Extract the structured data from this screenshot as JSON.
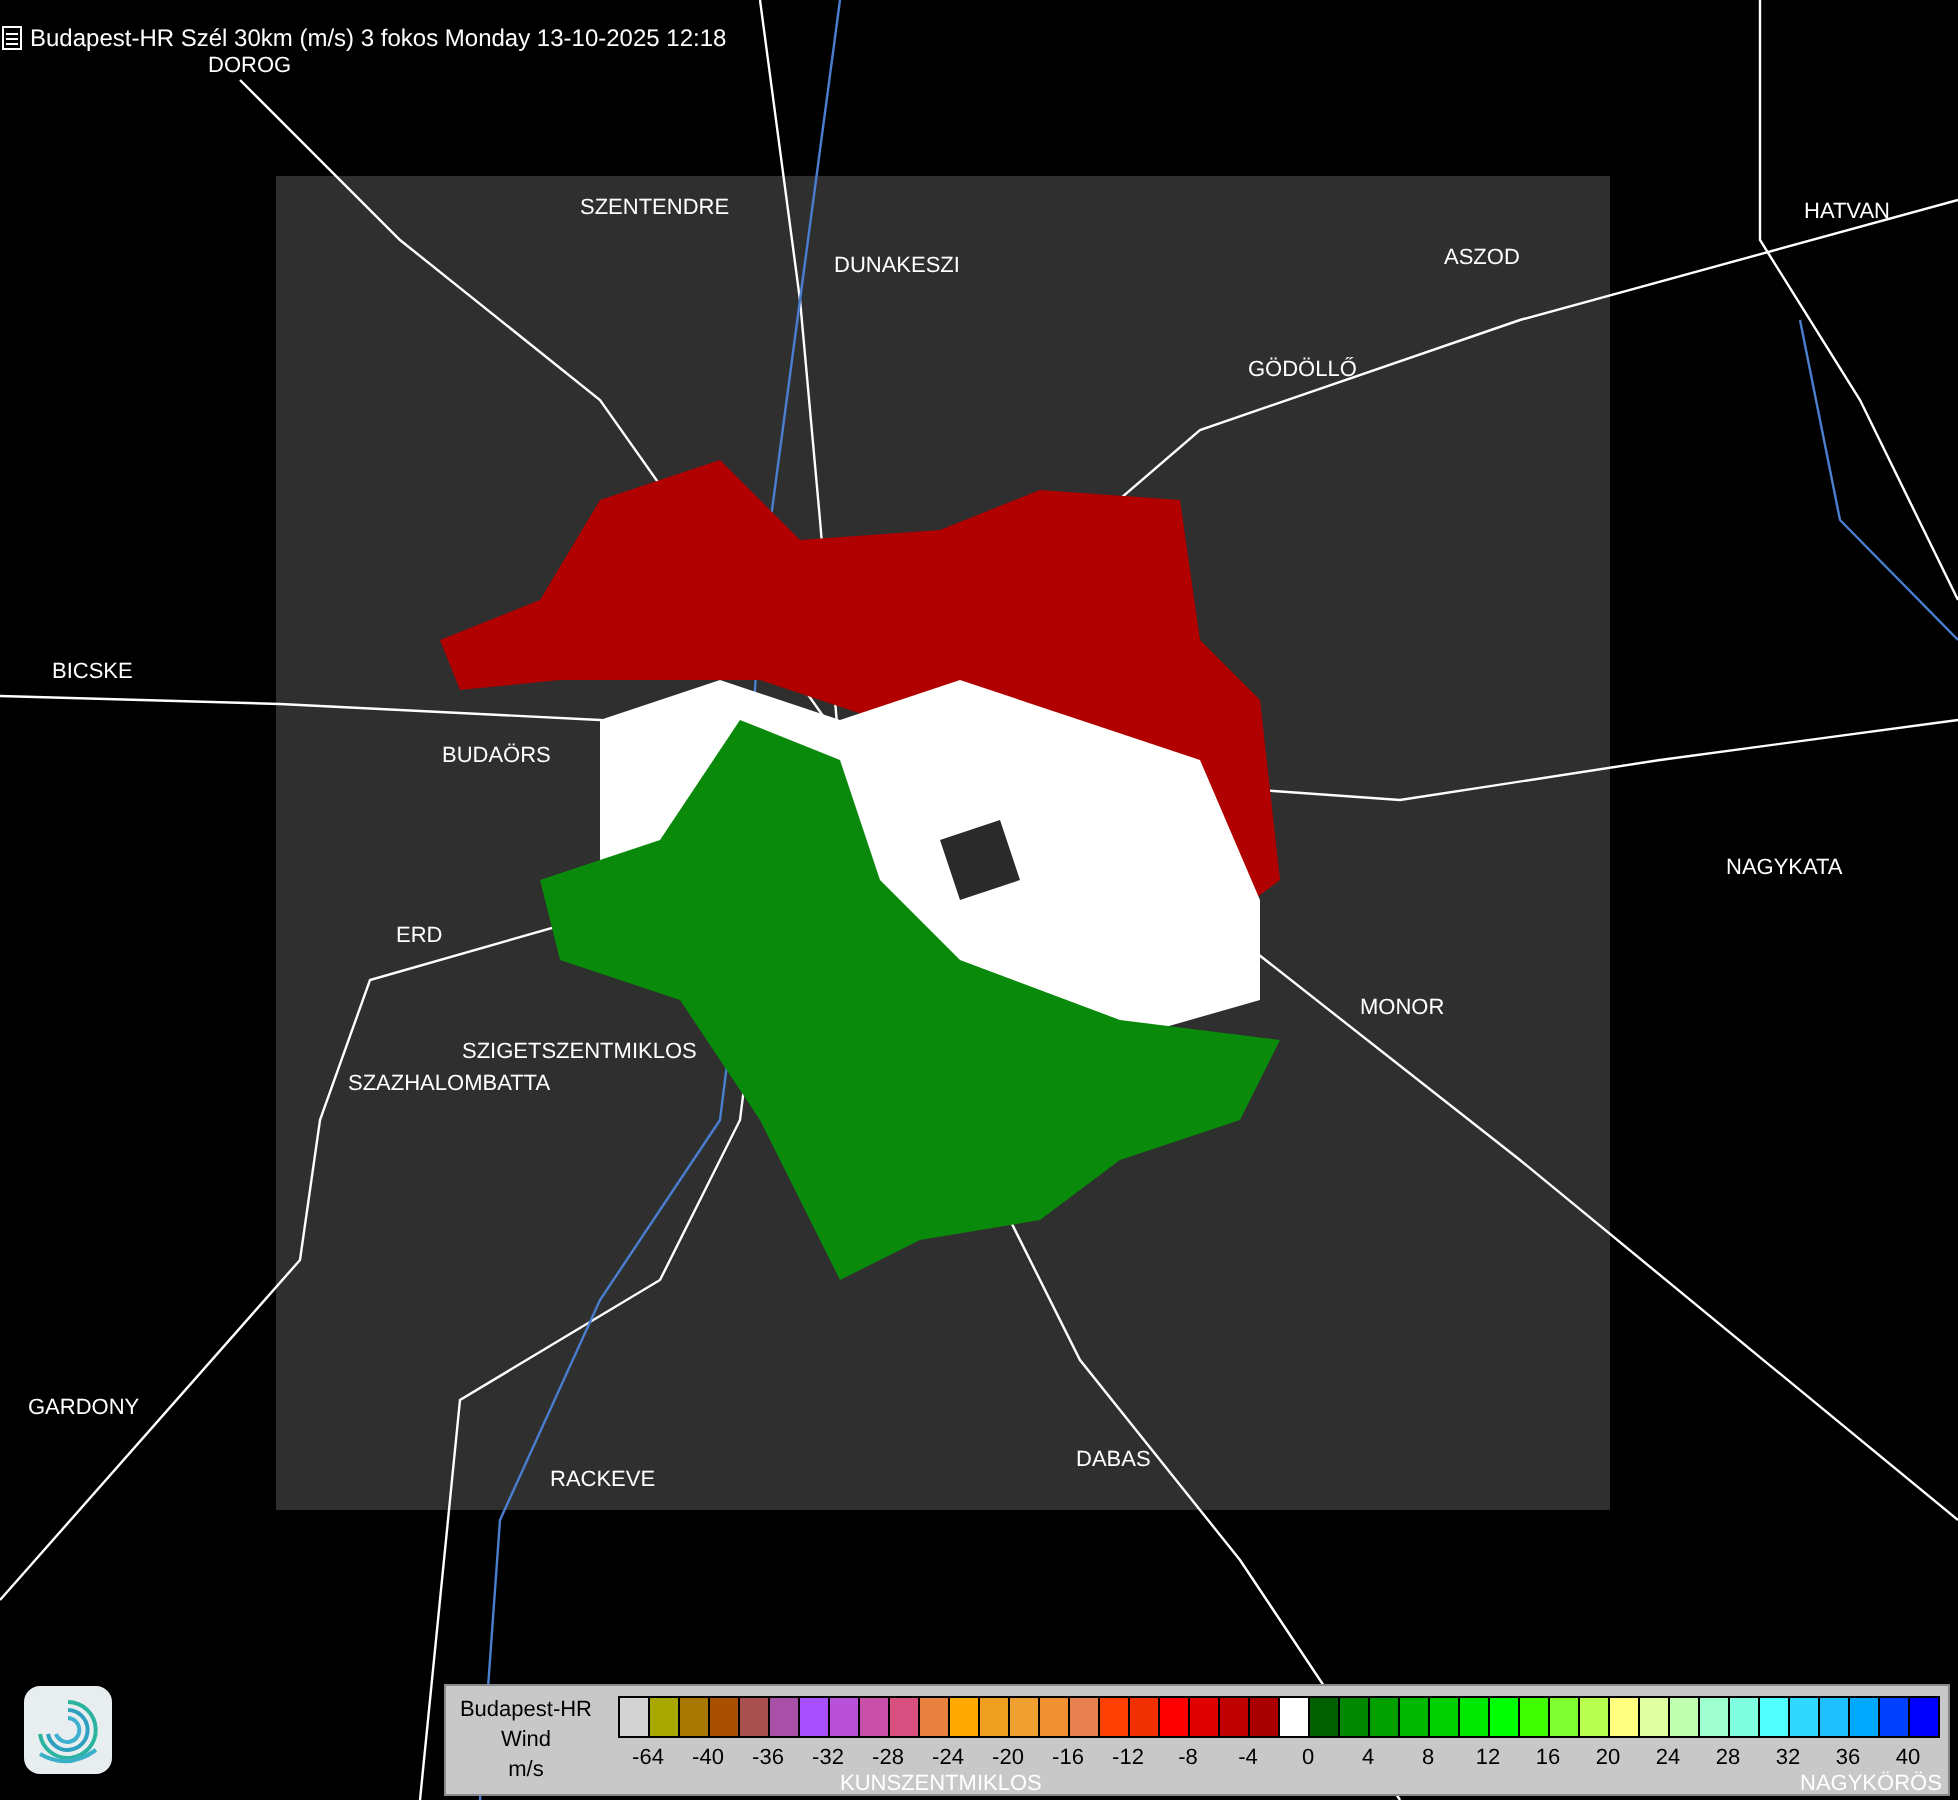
{
  "title": "Budapest-HR Szél 30km (m/s) 3 fokos Monday 13-10-2025 12:18",
  "cities": [
    {
      "name": "DOROG"
    },
    {
      "name": "SZENTENDRE"
    },
    {
      "name": "DUNAKESZI"
    },
    {
      "name": "ASZOD"
    },
    {
      "name": "HATVAN"
    },
    {
      "name": "GÖDÖLLŐ"
    },
    {
      "name": "BICSKE"
    },
    {
      "name": "BUDAÖRS"
    },
    {
      "name": "NAGYKATA"
    },
    {
      "name": "ERD"
    },
    {
      "name": "MONOR"
    },
    {
      "name": "SZIGETSZENTMIKLOS"
    },
    {
      "name": "SZAZHALOMBATTA"
    },
    {
      "name": "GARDONY"
    },
    {
      "name": "RACKEVE"
    },
    {
      "name": "DABAS"
    },
    {
      "name": "KUNSZENTMIKLOS"
    },
    {
      "name": "NAGYKÖRÖS"
    }
  ],
  "legend": {
    "lines": [
      "Budapest-HR",
      "Wind",
      "m/s"
    ],
    "swatches": [
      {
        "color": "#d3d3d3"
      },
      {
        "color": "#a8a800"
      },
      {
        "color": "#a87800"
      },
      {
        "color": "#a85000"
      },
      {
        "color": "#a85050"
      },
      {
        "color": "#a850a8"
      },
      {
        "color": "#a850ff"
      },
      {
        "color": "#b850d8"
      },
      {
        "color": "#c850a8"
      },
      {
        "color": "#d85080"
      },
      {
        "color": "#e88040"
      },
      {
        "color": "#ffa800"
      },
      {
        "color": "#f0a020"
      },
      {
        "color": "#f0a030"
      },
      {
        "color": "#f09030"
      },
      {
        "color": "#e88050"
      },
      {
        "color": "#ff4000"
      },
      {
        "color": "#f03000"
      },
      {
        "color": "#ff0000"
      },
      {
        "color": "#e00000"
      },
      {
        "color": "#c00000"
      },
      {
        "color": "#a80000"
      },
      {
        "color": "#ffffff"
      },
      {
        "color": "#006000"
      },
      {
        "color": "#008800"
      },
      {
        "color": "#00a000"
      },
      {
        "color": "#00b800"
      },
      {
        "color": "#00d000"
      },
      {
        "color": "#00e800"
      },
      {
        "color": "#00ff00"
      },
      {
        "color": "#40ff00"
      },
      {
        "color": "#80ff30"
      },
      {
        "color": "#b8ff50"
      },
      {
        "color": "#ffff80"
      },
      {
        "color": "#e0ffa0"
      },
      {
        "color": "#c0ffb0"
      },
      {
        "color": "#a0ffd0"
      },
      {
        "color": "#80ffe0"
      },
      {
        "color": "#50ffff"
      },
      {
        "color": "#30d8ff"
      },
      {
        "color": "#20c0ff"
      },
      {
        "color": "#00a8ff"
      },
      {
        "color": "#0040ff"
      },
      {
        "color": "#0000ff"
      }
    ],
    "ticks": [
      "-64",
      "-40",
      "-36",
      "-32",
      "-28",
      "-24",
      "-20",
      "-16",
      "-12",
      "-8",
      "-4",
      "0",
      "4",
      "8",
      "12",
      "16",
      "20",
      "24",
      "28",
      "32",
      "36",
      "40"
    ]
  }
}
